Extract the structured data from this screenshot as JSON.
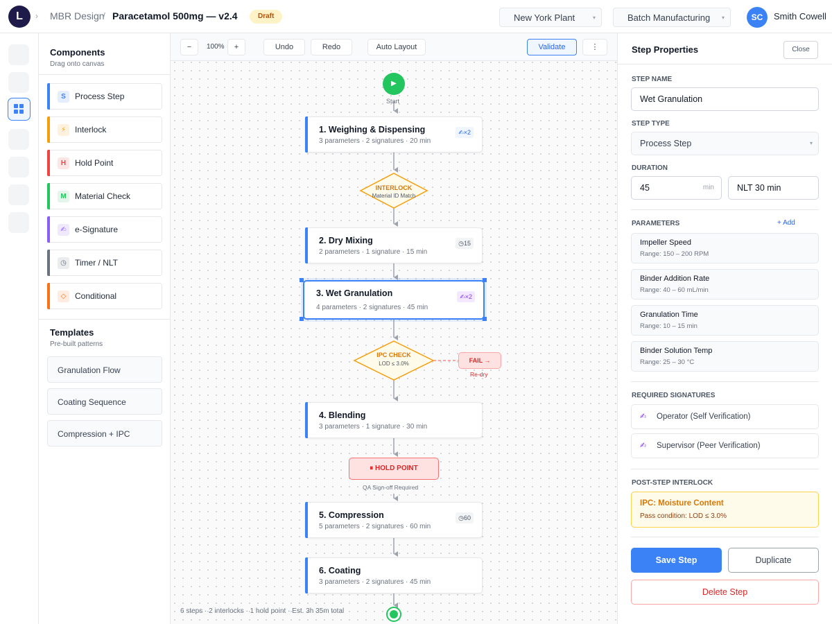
{
  "header": {
    "logo_letter": "L",
    "breadcrumb": [
      "MBR Design",
      "Paracetamol 500mg — v2.4"
    ],
    "status_badge": "Draft",
    "plant_select": "New York Plant",
    "process_select": "Batch Manufacturing",
    "user_initials": "SC",
    "user_name": "Smith Cowell"
  },
  "components_panel": {
    "title": "Components",
    "subtitle": "Drag onto canvas",
    "items": [
      {
        "icon": "S",
        "label": "Process Step",
        "color": "#3b82f6"
      },
      {
        "icon": "⚡",
        "label": "Interlock",
        "color": "#f59e0b"
      },
      {
        "icon": "H",
        "label": "Hold Point",
        "color": "#ef4444"
      },
      {
        "icon": "M",
        "label": "Material Check",
        "color": "#22c55e"
      },
      {
        "icon": "✍",
        "label": "e-Signature",
        "color": "#8b5cf6"
      },
      {
        "icon": "◷",
        "label": "Timer / NLT",
        "color": "#6b7280"
      },
      {
        "icon": "◇",
        "label": "Conditional",
        "color": "#f97316"
      }
    ],
    "templates_title": "Templates",
    "templates_subtitle": "Pre-built patterns",
    "templates": [
      "Granulation Flow",
      "Coating Sequence",
      "Compression + IPC"
    ]
  },
  "canvas_toolbar": {
    "zoom_out": "−",
    "zoom_level": "100%",
    "zoom_in": "+",
    "undo": "Undo",
    "redo": "Redo",
    "auto_layout": "Auto Layout",
    "validate": "Validate",
    "more": "⋮"
  },
  "flow": {
    "start_label": "Start",
    "start_icon": "▶",
    "steps": [
      {
        "title": "1. Weighing & Dispensing",
        "meta": "3 parameters · 2 signatures · 20 min",
        "badge": "✍×2"
      },
      {
        "title": "2. Dry Mixing",
        "meta": "2 parameters · 1 signature · 15 min",
        "badge": "◷15"
      },
      {
        "title": "3. Wet Granulation",
        "meta": "4 parameters · 2 signatures · 45 min",
        "badge": "✍×2"
      },
      {
        "title": "4. Blending",
        "meta": "3 parameters · 1 signature · 30 min",
        "badge": ""
      },
      {
        "title": "5. Compression",
        "meta": "5 parameters · 2 signatures · 60 min",
        "badge": "◷60"
      },
      {
        "title": "6. Coating",
        "meta": "3 parameters · 2 signatures · 45 min",
        "badge": ""
      }
    ],
    "interlock": {
      "title": "INTERLOCK",
      "sub": "Material ID Match"
    },
    "ipc_check": {
      "title": "IPC CHECK",
      "sub": "LOD ≤ 3.0%"
    },
    "fail_tag": "FAIL →",
    "fail_sub": "Re-dry",
    "hold_point": "⏸ HOLD POINT",
    "hold_sub": "QA Sign-off Required",
    "footer_stats": "6 steps · 2 interlocks · 1 hold point · Est. 3h 35m total"
  },
  "properties": {
    "title": "Step Properties",
    "close": "Close",
    "step_name_label": "STEP NAME",
    "step_name": "Wet Granulation",
    "step_type_label": "STEP TYPE",
    "step_type": "Process Step",
    "duration_label": "DURATION",
    "duration_value": "45",
    "duration_unit": "min",
    "nlt_value": "NLT 30 min",
    "parameters_label": "PARAMETERS",
    "add_label": "+ Add",
    "parameters": [
      {
        "name": "Impeller Speed",
        "range": "Range: 150 – 200 RPM"
      },
      {
        "name": "Binder Addition Rate",
        "range": "Range: 40 – 60 mL/min"
      },
      {
        "name": "Granulation Time",
        "range": "Range: 10 – 15 min"
      },
      {
        "name": "Binder Solution Temp",
        "range": "Range: 25 – 30 °C"
      }
    ],
    "signatures_label": "REQUIRED SIGNATURES",
    "signatures": [
      "Operator (Self Verification)",
      "Supervisor (Peer Verification)"
    ],
    "signature_icon": "✍",
    "interlock_label": "POST-STEP INTERLOCK",
    "interlock_title": "IPC: Moisture Content",
    "interlock_cond": "Pass condition: LOD ≤ 3.0%",
    "save": "Save Step",
    "duplicate": "Duplicate",
    "delete": "Delete Step"
  }
}
